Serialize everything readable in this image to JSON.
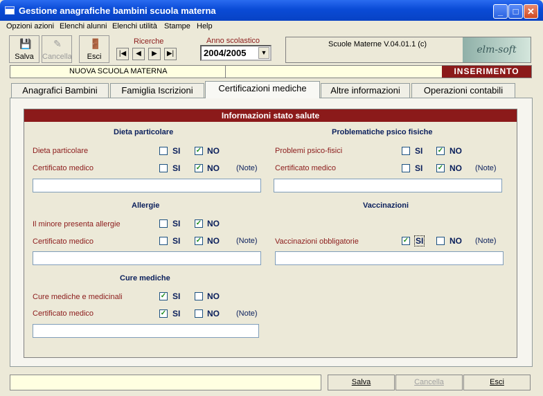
{
  "window": {
    "title": "Gestione anagrafiche bambini scuola materna",
    "min": "_",
    "max": "□",
    "close": "✕"
  },
  "menu": [
    "Opzioni azioni",
    "Elenchi alunni",
    "Elenchi utilità",
    "Stampe",
    "Help"
  ],
  "toolbar": {
    "save": "Salva",
    "delete": "Cancella",
    "exit": "Esci",
    "ricerche": "Ricerche",
    "anno_label": "Anno scolastico",
    "anno_value": "2004/2005",
    "version": "Scuole Materne V.04.01.1 (c)",
    "logo": "elm-soft"
  },
  "nav": [
    "|◀",
    "◀",
    "▶",
    "▶|"
  ],
  "school": {
    "name": "NUOVA SCUOLA MATERNA",
    "mode": "INSERIMENTO"
  },
  "tabs": [
    "Anagrafici Bambini",
    "Famiglia Iscrizioni",
    "Certificazioni mediche",
    "Altre informazioni",
    "Operazioni contabili"
  ],
  "panel": {
    "header": "Informazioni stato salute",
    "si": "SI",
    "no": "NO",
    "note": "(Note)",
    "dieta": {
      "title": "Dieta particolare",
      "q1": "Dieta particolare",
      "q2": "Certificato medico"
    },
    "allergie": {
      "title": "Allergie",
      "q1": "Il minore presenta allergie",
      "q2": "Certificato medico"
    },
    "cure": {
      "title": "Cure mediche",
      "q1": "Cure mediche e medicinali",
      "q2": "Certificato medico"
    },
    "psico": {
      "title": "Problematiche psico fisiche",
      "q1": "Problemi psico-fisici",
      "q2": "Certificato medico"
    },
    "vacc": {
      "title": "Vaccinazioni",
      "q1": "Vaccinazioni obbligatorie"
    }
  },
  "status": {
    "save": "Salva",
    "delete": "Cancella",
    "exit": "Esci"
  },
  "checkmark": "✓"
}
